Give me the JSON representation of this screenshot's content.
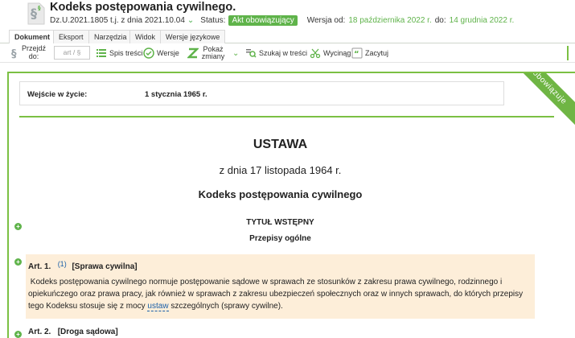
{
  "header": {
    "title": "Kodeks postępowania cywilnego.",
    "dzu": "Dz.U.2021.1805 t.j. z dnia 2021.10.04",
    "status_label": "Status:",
    "status_badge": "Akt obowiązujący",
    "version_from_label": "Wersja od:",
    "version_from": "18 października 2022 r.",
    "version_to_label": "do:",
    "version_to": "14 grudnia 2022 r."
  },
  "tabs": [
    "Dokument",
    "Eksport",
    "Narzędzia",
    "Widok",
    "Wersje językowe"
  ],
  "toolbar": {
    "goto_label": "Przejdź do:",
    "goto_placeholder": "art / §",
    "toc": "Spis treści",
    "versions": "Wersje",
    "show_changes": "Pokaż zmiany",
    "search": "Szukaj w treści",
    "excerpt": "Wycinąg",
    "quote": "Zacytuj"
  },
  "ribbon": "obowiązuje",
  "entry": {
    "label": "Wejście w życie:",
    "value": "1 stycznia 1965 r."
  },
  "document": {
    "type": "USTAWA",
    "date": "z dnia 17 listopada 1964 r.",
    "name": "Kodeks postępowania cywilnego",
    "title_section": "TYTUŁ WSTĘPNY",
    "title_subtitle": "Przepisy ogólne"
  },
  "article1": {
    "label": "Art. 1.",
    "ref": "(1)",
    "heading": "[Sprawa cywilna]",
    "text_before": "Kodeks postępowania cywilnego normuje postępowanie sądowe w sprawach ze stosunków z zakresu prawa cywilnego, rodzinnego i opiekuńczego oraz prawa pracy, jak również w sprawach z zakresu ubezpieczeń społecznych oraz w innych sprawach, do których przepisy tego Kodeksu stosuje się z mocy ",
    "link": "ustaw",
    "text_after": " szczególnych (sprawy cywilne)."
  },
  "article2": {
    "label": "Art. 2.",
    "heading": "[Droga sądowa]"
  },
  "colors": {
    "accent_green": "#5fb34a",
    "link_blue": "#1a5fa8",
    "article_bg": "#fdeed9"
  }
}
